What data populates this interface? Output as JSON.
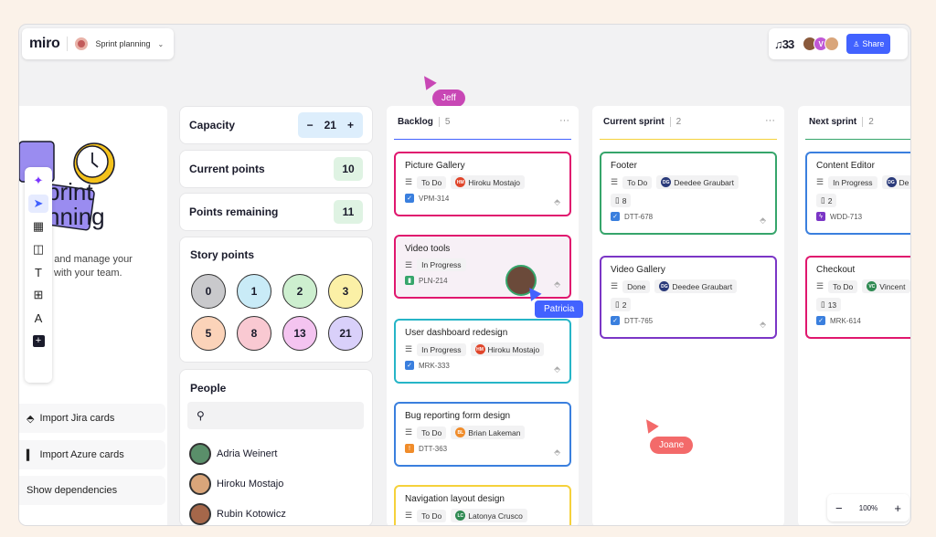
{
  "topbar": {
    "logo": "miro",
    "board_name": "Sprint planning",
    "reactions": "♫33",
    "share_label": "Share",
    "collaborator_initial": "V"
  },
  "cursors": {
    "jeff": "Jeff",
    "patricia": "Patricia",
    "joane": "Joane"
  },
  "left_panel": {
    "title_line1": "print",
    "title_line2": "nning",
    "subtext_line1": "e, and manage your",
    "subtext_line2": "with your team.",
    "import_jira": "Import Jira cards",
    "import_azure": "Import Azure cards",
    "show_dependencies": "Show dependencies"
  },
  "stats": {
    "capacity_label": "Capacity",
    "capacity_value": "21",
    "minus": "−",
    "plus": "+",
    "current_points_label": "Current points",
    "current_points_value": "10",
    "points_remaining_label": "Points remaining",
    "points_remaining_value": "11"
  },
  "story_points": {
    "label": "Story points",
    "values": [
      "0",
      "1",
      "2",
      "3",
      "5",
      "8",
      "13",
      "21"
    ]
  },
  "people": {
    "label": "People",
    "list": [
      "Adria Weinert",
      "Hiroku Mostajo",
      "Rubin Kotowicz"
    ]
  },
  "columns": [
    {
      "name": "Backlog",
      "count": "5",
      "cards": [
        {
          "title": "Picture Gallery",
          "status": "To Do",
          "assignee": "Hiroku Mostajo",
          "id": "VPM-314"
        },
        {
          "title": "Video tools",
          "status": "In Progress",
          "id": "PLN-214"
        },
        {
          "title": "User dashboard redesign",
          "status": "In Progress",
          "assignee": "Hiroku Mostajo",
          "id": "MRK-333"
        },
        {
          "title": "Bug reporting form design",
          "status": "To Do",
          "assignee": "Brian Lakeman",
          "id": "DTT-363"
        },
        {
          "title": "Navigation layout design",
          "status": "To Do",
          "assignee": "Latonya Crusco"
        }
      ]
    },
    {
      "name": "Current sprint",
      "count": "2",
      "cards": [
        {
          "title": "Footer",
          "status": "To Do",
          "assignee": "Deedee Graubart",
          "points": "8",
          "id": "DTT-678"
        },
        {
          "title": "Video Gallery",
          "status": "Done",
          "assignee": "Deedee Graubart",
          "points": "2",
          "id": "DTT-765"
        }
      ]
    },
    {
      "name": "Next sprint",
      "count": "2",
      "cards": [
        {
          "title": "Content Editor",
          "status": "In Progress",
          "assignee": "De",
          "points": "2",
          "id": "WDD-713"
        },
        {
          "title": "Checkout",
          "status": "To Do",
          "assignee": "Vincent",
          "points": "13",
          "id": "MRK-614"
        }
      ]
    }
  ],
  "zoom": {
    "minus": "−",
    "value": "100%",
    "plus": "+"
  },
  "icons": {
    "more": "ellipsis-icon",
    "status": "lines-icon",
    "jira": "jira-icon",
    "points": "card-icon"
  },
  "colors": {
    "accent": "#4262ff",
    "pink": "#e0176e",
    "teal": "#26b5c7",
    "blue": "#3a7fde",
    "yellow": "#f5d13b",
    "green": "#36a56b",
    "purple": "#7b36c6"
  }
}
